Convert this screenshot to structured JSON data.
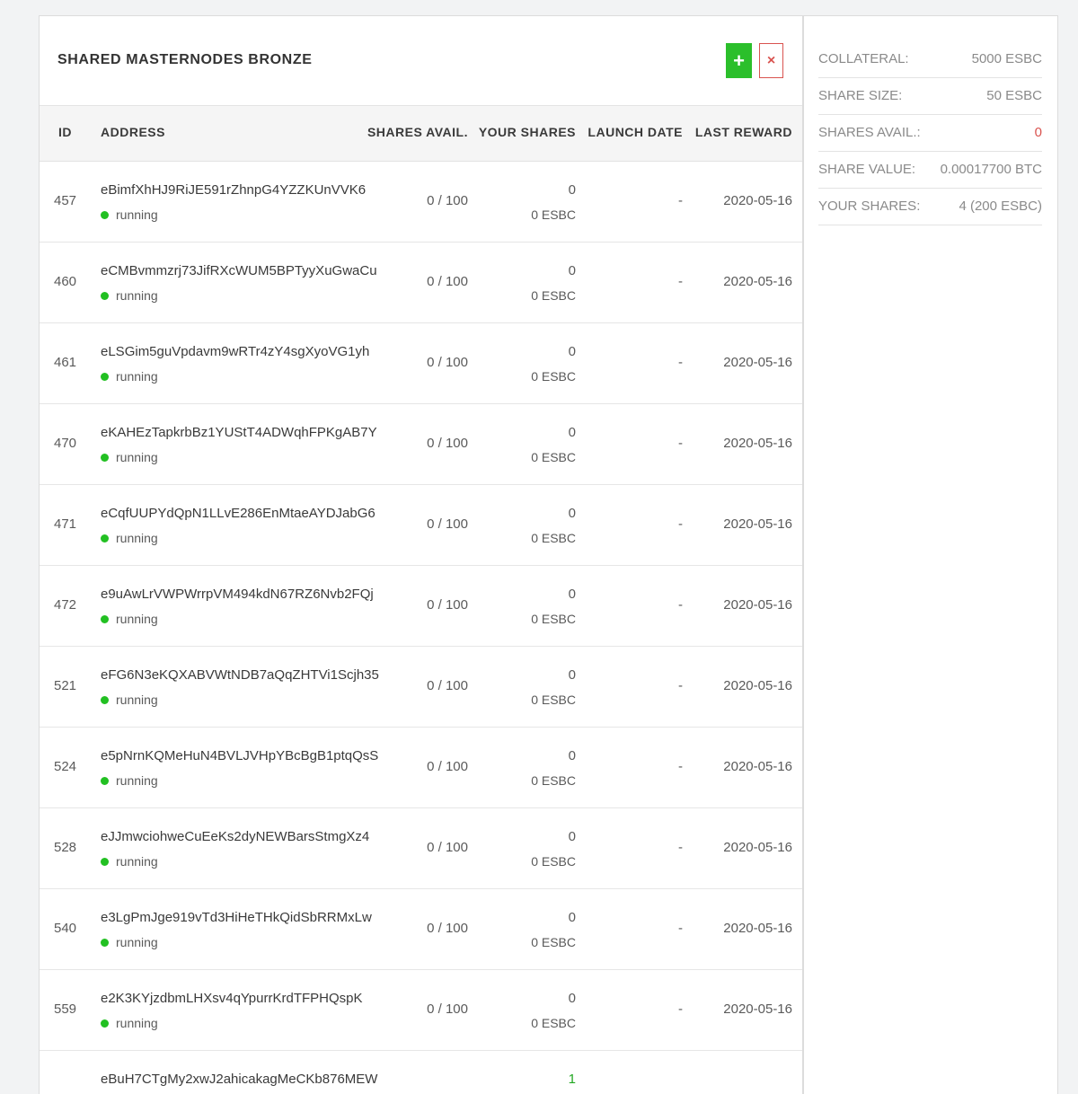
{
  "panel": {
    "title": "SHARED MASTERNODES BRONZE",
    "add_label": "+",
    "remove_label": "×"
  },
  "table": {
    "columns": [
      "ID",
      "ADDRESS",
      "SHARES AVAIL.",
      "YOUR SHARES",
      "LAUNCH DATE",
      "LAST REWARD"
    ],
    "rows": [
      {
        "id": "457",
        "address": "eBimfXhHJ9RiJE591rZhnpG4YZZKUnVVK6",
        "status": "running",
        "avail": "0 / 100",
        "your_shares": "0",
        "your_esbc": "0 ESBC",
        "launch": "-",
        "reward": "2020-05-16"
      },
      {
        "id": "460",
        "address": "eCMBvmmzrj73JifRXcWUM5BPTyyXuGwaCu",
        "status": "running",
        "avail": "0 / 100",
        "your_shares": "0",
        "your_esbc": "0 ESBC",
        "launch": "-",
        "reward": "2020-05-16"
      },
      {
        "id": "461",
        "address": "eLSGim5guVpdavm9wRTr4zY4sgXyoVG1yh",
        "status": "running",
        "avail": "0 / 100",
        "your_shares": "0",
        "your_esbc": "0 ESBC",
        "launch": "-",
        "reward": "2020-05-16"
      },
      {
        "id": "470",
        "address": "eKAHEzTapkrbBz1YUStT4ADWqhFPKgAB7Y",
        "status": "running",
        "avail": "0 / 100",
        "your_shares": "0",
        "your_esbc": "0 ESBC",
        "launch": "-",
        "reward": "2020-05-16"
      },
      {
        "id": "471",
        "address": "eCqfUUPYdQpN1LLvE286EnMtaeAYDJabG6",
        "status": "running",
        "avail": "0 / 100",
        "your_shares": "0",
        "your_esbc": "0 ESBC",
        "launch": "-",
        "reward": "2020-05-16"
      },
      {
        "id": "472",
        "address": "e9uAwLrVWPWrrpVM494kdN67RZ6Nvb2FQj",
        "status": "running",
        "avail": "0 / 100",
        "your_shares": "0",
        "your_esbc": "0 ESBC",
        "launch": "-",
        "reward": "2020-05-16"
      },
      {
        "id": "521",
        "address": "eFG6N3eKQXABVWtNDB7aQqZHTVi1Scjh35",
        "status": "running",
        "avail": "0 / 100",
        "your_shares": "0",
        "your_esbc": "0 ESBC",
        "launch": "-",
        "reward": "2020-05-16"
      },
      {
        "id": "524",
        "address": "e5pNrnKQMeHuN4BVLJVHpYBcBgB1ptqQsS",
        "status": "running",
        "avail": "0 / 100",
        "your_shares": "0",
        "your_esbc": "0 ESBC",
        "launch": "-",
        "reward": "2020-05-16"
      },
      {
        "id": "528",
        "address": "eJJmwciohweCuEeKs2dyNEWBarsStmgXz4",
        "status": "running",
        "avail": "0 / 100",
        "your_shares": "0",
        "your_esbc": "0 ESBC",
        "launch": "-",
        "reward": "2020-05-16"
      },
      {
        "id": "540",
        "address": "e3LgPmJge919vTd3HiHeTHkQidSbRRMxLw",
        "status": "running",
        "avail": "0 / 100",
        "your_shares": "0",
        "your_esbc": "0 ESBC",
        "launch": "-",
        "reward": "2020-05-16"
      },
      {
        "id": "559",
        "address": "e2K3KYjzdbmLHXsv4qYpurrKrdTFPHQspK",
        "status": "running",
        "avail": "0 / 100",
        "your_shares": "0",
        "your_esbc": "0 ESBC",
        "launch": "-",
        "reward": "2020-05-16"
      },
      {
        "id": "",
        "address": "eBuH7CTgMy2xwJ2ahicakagMeCKb876MEW",
        "status": "",
        "avail": "",
        "your_shares": "1",
        "your_esbc": "",
        "launch": "",
        "reward": ""
      }
    ]
  },
  "stats": [
    {
      "label": "COLLATERAL:",
      "value": "5000 ESBC"
    },
    {
      "label": "SHARE SIZE:",
      "value": "50 ESBC"
    },
    {
      "label": "SHARES AVAIL.:",
      "value": "0"
    },
    {
      "label": "SHARE VALUE:",
      "value": "0.00017700 BTC"
    },
    {
      "label": "YOUR SHARES:",
      "value": "4 (200 ESBC)"
    }
  ],
  "colors": {
    "add_button": "#2bbf2b",
    "remove_button": "#d9534f",
    "status_running": "#22c022",
    "shares_avail_zero": "#d9534f"
  }
}
